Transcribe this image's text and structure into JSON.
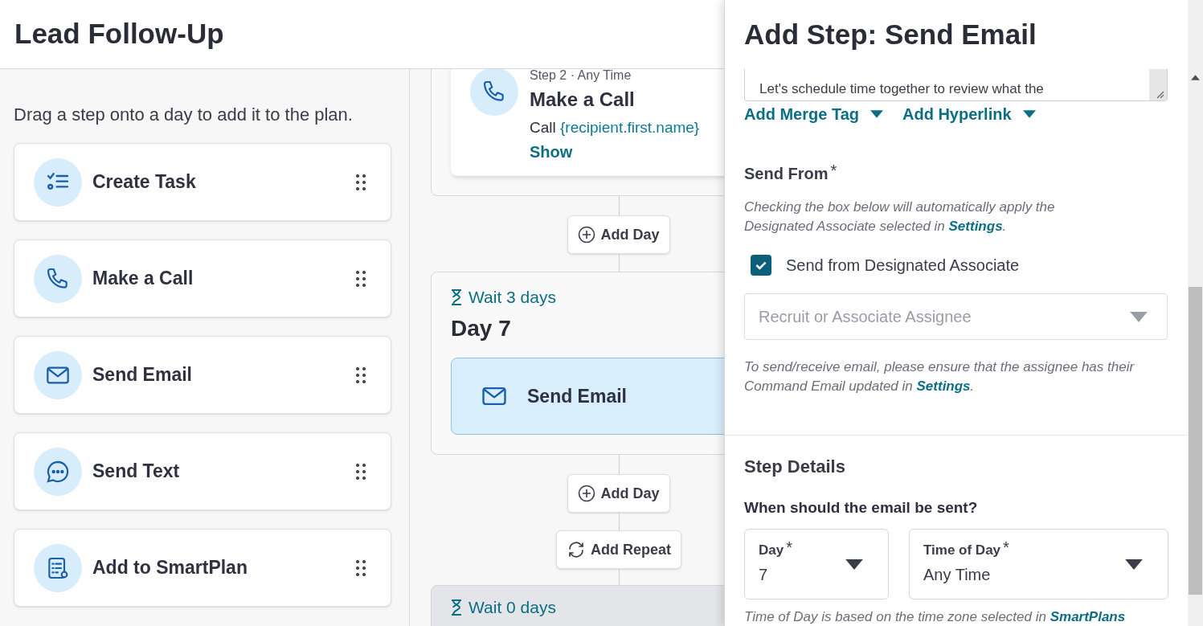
{
  "header": {
    "title": "Lead Follow-Up"
  },
  "palette": {
    "instructions": "Drag a step onto a day to add it to the plan.",
    "steps": [
      {
        "label": "Create Task",
        "kind": "task"
      },
      {
        "label": "Make a Call",
        "kind": "phone"
      },
      {
        "label": "Send Email",
        "kind": "email"
      },
      {
        "label": "Send Text",
        "kind": "chat"
      },
      {
        "label": "Add to SmartPlan",
        "kind": "plan"
      }
    ]
  },
  "timeline": [
    {
      "kind": "group",
      "muted": false,
      "steps": [
        {
          "kind": "phone",
          "meta": "Step 2 · Any Time",
          "title": "Make a Call",
          "description": "Call",
          "merge_tag": "{recipient.first.name}",
          "link": "Show",
          "selected": false
        }
      ]
    },
    {
      "kind": "add_day",
      "label": "Add Day"
    },
    {
      "kind": "group",
      "muted": false,
      "wait": "Wait 3 days",
      "day": "Day 7",
      "steps": [
        {
          "kind": "email",
          "title": "Send Email",
          "selected": true
        }
      ]
    },
    {
      "kind": "add_day",
      "label": "Add Day"
    },
    {
      "kind": "add_repeat",
      "label": "Add Repeat"
    },
    {
      "kind": "group",
      "muted": true,
      "wait": "Wait 0 days"
    }
  ],
  "panel": {
    "title": "Add Step: Send Email",
    "body_preview": "Let's schedule time together to review what the",
    "menus": [
      "Add Merge Tag",
      "Add Hyperlink"
    ],
    "send_from": {
      "label": "Send From",
      "required_mark": "*",
      "help": "Checking the box below will automatically apply the Designated Associate selected in ",
      "help_link": "Settings",
      "help_end": ".",
      "checkbox": {
        "label": "Send from Designated Associate",
        "checked": true
      },
      "assignee": {
        "placeholder": "Recruit or Associate Assignee"
      },
      "note": "To send/receive email, please ensure that the assignee has their Command Email updated in ",
      "note_link": "Settings",
      "note_end": "."
    },
    "step_details": {
      "title": "Step Details",
      "question": "When should the email be sent?",
      "fields": [
        {
          "label": "Day",
          "required_mark": "*",
          "value": "7"
        },
        {
          "label": "Time of Day",
          "required_mark": "*",
          "value": "Any Time"
        }
      ],
      "footnote": "Time of Day is based on the time zone selected in ",
      "footnote_link": "SmartPlans"
    }
  }
}
